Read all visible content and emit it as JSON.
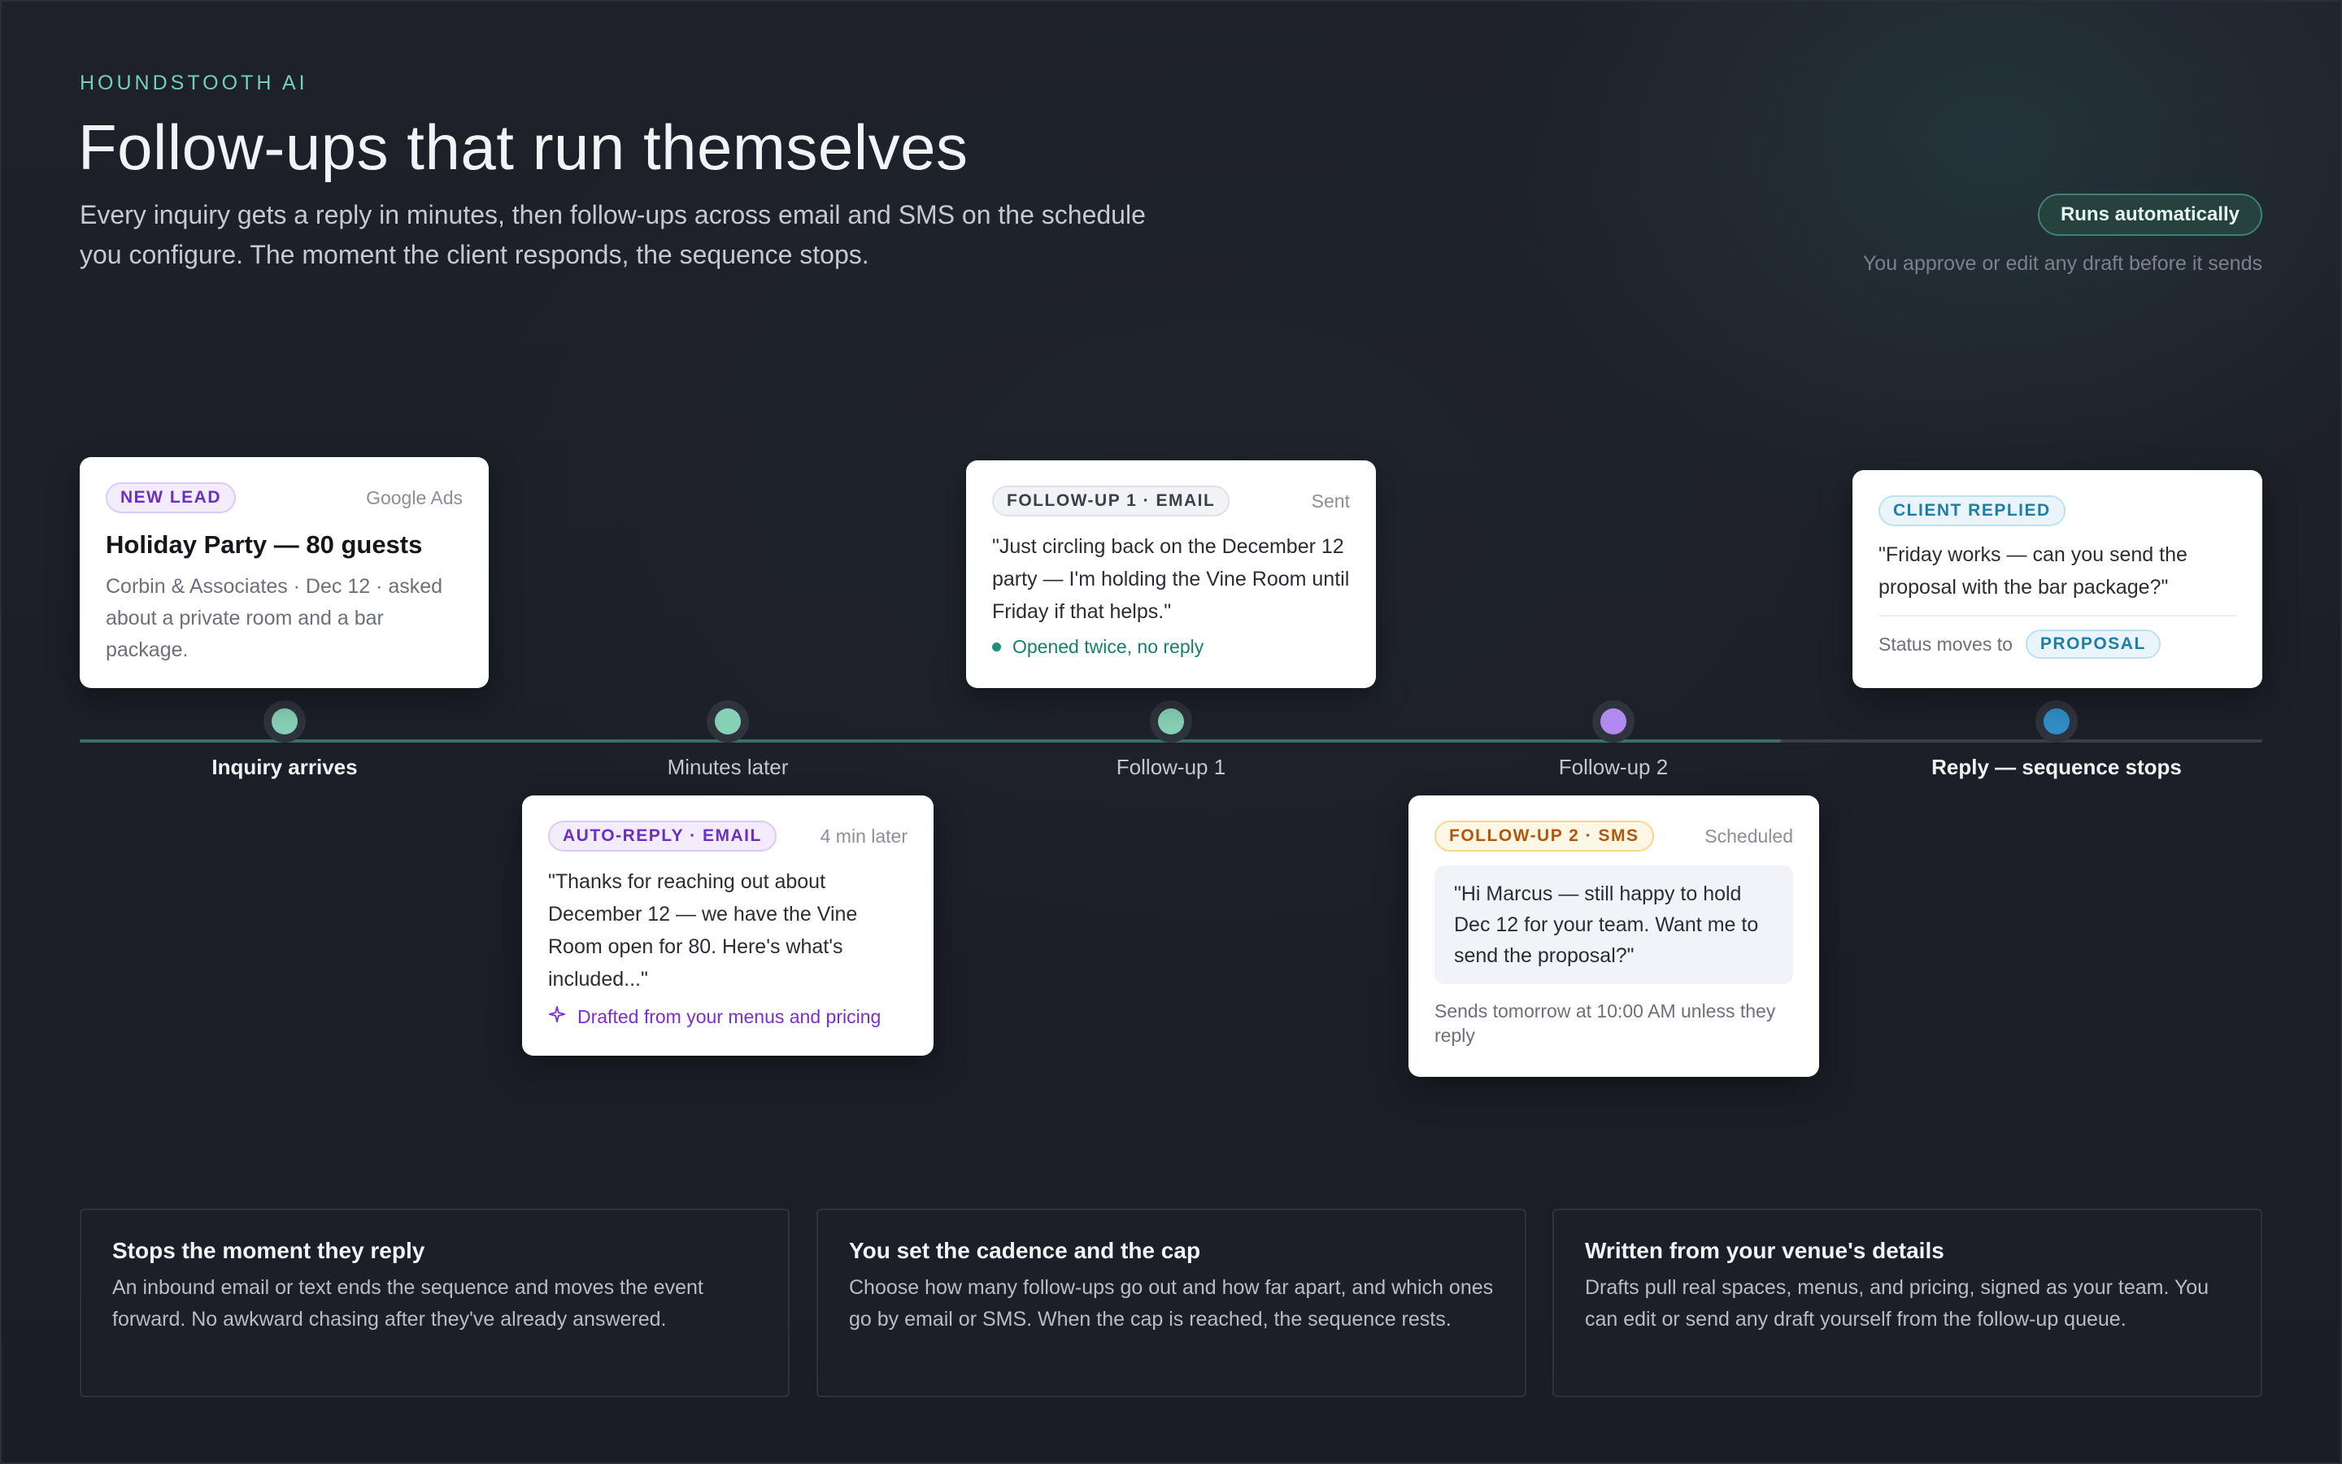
{
  "brand": "HOUNDSTOOTH AI",
  "headline": "Follow-ups that run themselves",
  "subtitle": "Every inquiry gets a reply in minutes, then follow-ups across email and SMS on the schedule you configure. The moment the client responds, the sequence stops.",
  "auto_pill": "Runs automatically",
  "approve_note": "You approve or edit any draft before it sends",
  "colors": {
    "accent_teal": "#6fd1bb",
    "node_green": "#86d0b6",
    "node_purple": "#b18af0",
    "node_blue": "#2f8fc7"
  },
  "timeline": {
    "steps": [
      {
        "label": "Inquiry arrives",
        "strong": true
      },
      {
        "label": "Minutes later",
        "strong": false
      },
      {
        "label": "Follow-up 1",
        "strong": false
      },
      {
        "label": "Follow-up 2",
        "strong": false
      },
      {
        "label": "Reply — sequence stops",
        "strong": true
      }
    ]
  },
  "cards": {
    "lead": {
      "badge": "NEW LEAD",
      "meta": "Google Ads",
      "title": "Holiday Party — 80 guests",
      "body": "Corbin & Associates · Dec 12 · asked about a private room and a bar package."
    },
    "auto_reply": {
      "badge": "AUTO-REPLY · EMAIL",
      "meta": "4 min later",
      "quote": "\"Thanks for reaching out about December 12 — we have the Vine Room open for 80. Here's what's included...\"",
      "foot_icon": "sparkle-icon",
      "foot": "Drafted from your menus and pricing"
    },
    "followup1": {
      "badge": "FOLLOW-UP 1 · EMAIL",
      "meta": "Sent",
      "quote": "\"Just circling back on the December 12 party — I'm holding the Vine Room until Friday if that helps.\"",
      "foot": "Opened twice, no reply"
    },
    "followup2": {
      "badge": "FOLLOW-UP 2 · SMS",
      "meta": "Scheduled",
      "quote": "\"Hi Marcus — still happy to hold Dec 12 for your team. Want me to send the proposal?\"",
      "foot": "Sends tomorrow at 10:00 AM unless they reply"
    },
    "reply": {
      "badge": "CLIENT REPLIED",
      "quote": "\"Friday works — can you send the proposal with the bar package?\"",
      "status_label": "Status moves to",
      "status_badge": "PROPOSAL"
    }
  },
  "features": [
    {
      "title": "Stops the moment they reply",
      "text": "An inbound email or text ends the sequence and moves the event forward. No awkward chasing after they've already answered."
    },
    {
      "title": "You set the cadence and the cap",
      "text": "Choose how many follow-ups go out and how far apart, and which ones go by email or SMS. When the cap is reached, the sequence rests."
    },
    {
      "title": "Written from your venue's details",
      "text": "Drafts pull real spaces, menus, and pricing, signed as your team. You can edit or send any draft yourself from the follow-up queue."
    }
  ]
}
